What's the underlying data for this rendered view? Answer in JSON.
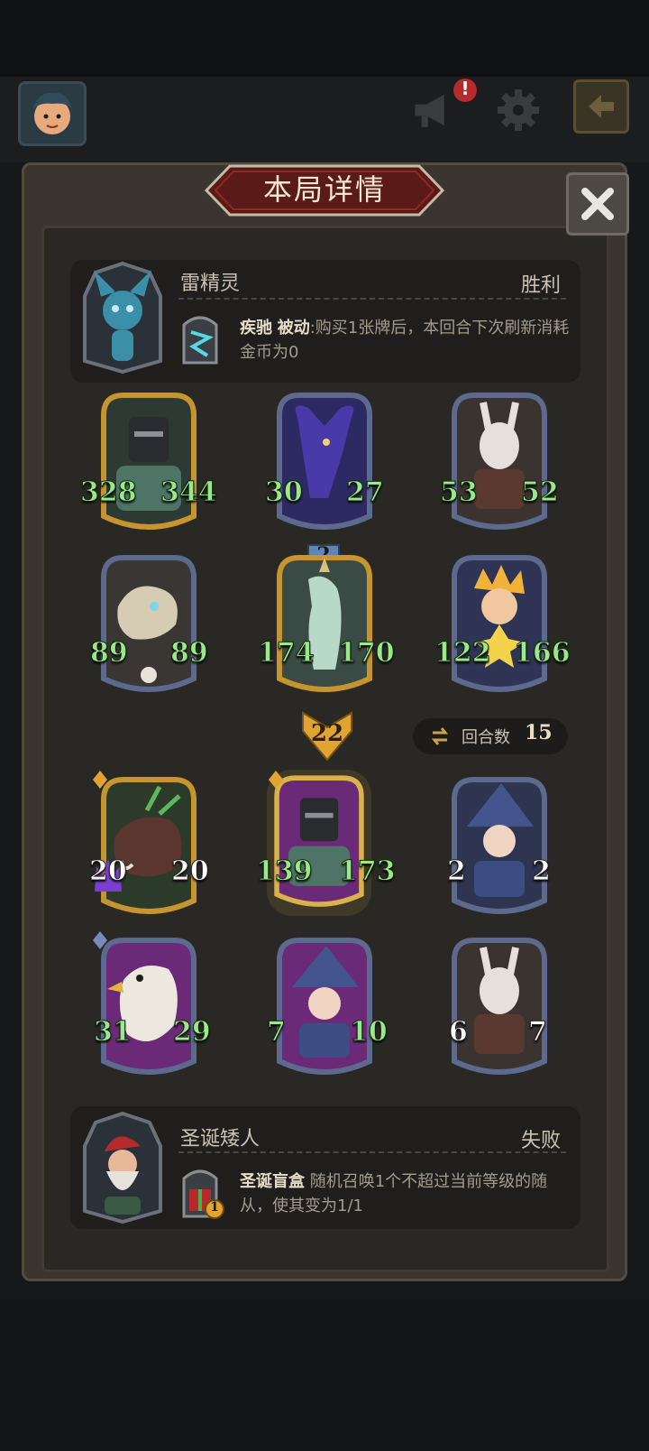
{
  "dialog": {
    "title": "本局详情"
  },
  "top_bar": {
    "icons": [
      "player-avatar-icon",
      "megaphone-icon",
      "gear-icon",
      "exit-icon"
    ],
    "notification": "!"
  },
  "winner": {
    "name": "雷精灵",
    "result": "胜利",
    "skill_name": "疾驰",
    "skill_type": "被动",
    "skill_desc": ":购买1张牌后，本回合下次刷新消耗金币为0"
  },
  "winner_board": [
    {
      "name": "knight",
      "attack": "328",
      "health": "344"
    },
    {
      "name": "cosmic-bull",
      "attack": "30",
      "health": "27"
    },
    {
      "name": "masked-rabbit",
      "attack": "53",
      "health": "52"
    },
    {
      "name": "bone-dragon",
      "attack": "89",
      "health": "89"
    },
    {
      "name": "spirit-horse",
      "attack": "174",
      "health": "170",
      "level": "2"
    },
    {
      "name": "star-boy",
      "attack": "122",
      "health": "166"
    }
  ],
  "damage": "22",
  "round": {
    "label": "回合数",
    "value": "15"
  },
  "loser_board": [
    {
      "name": "boar",
      "attack": "20",
      "health": "20"
    },
    {
      "name": "knight-gold",
      "attack": "139",
      "health": "173"
    },
    {
      "name": "wizard-blue",
      "attack": "2",
      "health": "2"
    },
    {
      "name": "eagle",
      "attack": "31",
      "health": "29"
    },
    {
      "name": "wizard-purple",
      "attack": "7",
      "health": "10"
    },
    {
      "name": "masked-rabbit-2",
      "attack": "6",
      "health": "7"
    }
  ],
  "loser": {
    "name": "圣诞矮人",
    "result": "失败",
    "skill_name": "圣诞盲盒",
    "skill_desc": "随机召唤1个不超过当前等级的随从，使其变为1/1",
    "skill_cost": "1"
  },
  "colors": {
    "gold_frame": "#c7952f",
    "blue_frame": "#5d6a8e",
    "purple_frame": "#7a3f9a",
    "stat_green": "#9be88a"
  }
}
